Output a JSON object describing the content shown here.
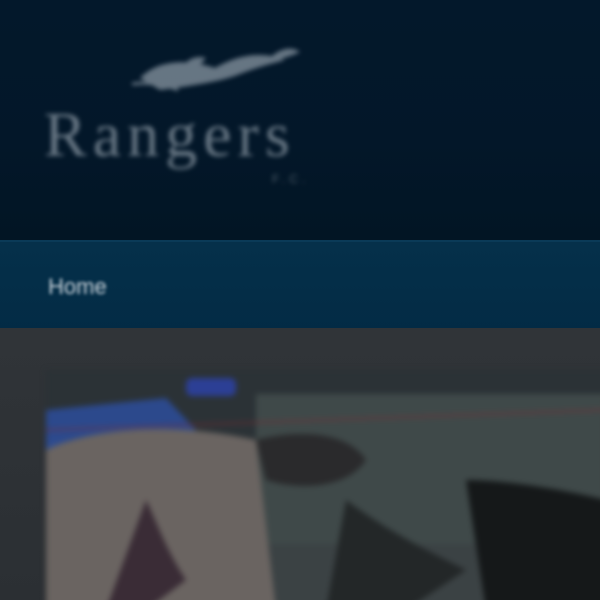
{
  "brand": {
    "name": "Rangers",
    "tagline": "F.C."
  },
  "nav": {
    "items": [
      {
        "label": "Home"
      }
    ]
  },
  "hero": {
    "alt": "Featured photo"
  },
  "colors": {
    "header_bg": "#03182b",
    "nav_bg": "#04304a",
    "content_bg": "#2f3337",
    "logo_text": "#b8c3cc",
    "nav_text": "#c9d3db",
    "accent_blue": "#2d4fa3"
  },
  "icons": {
    "logo_mark": "horse-rider-icon"
  }
}
